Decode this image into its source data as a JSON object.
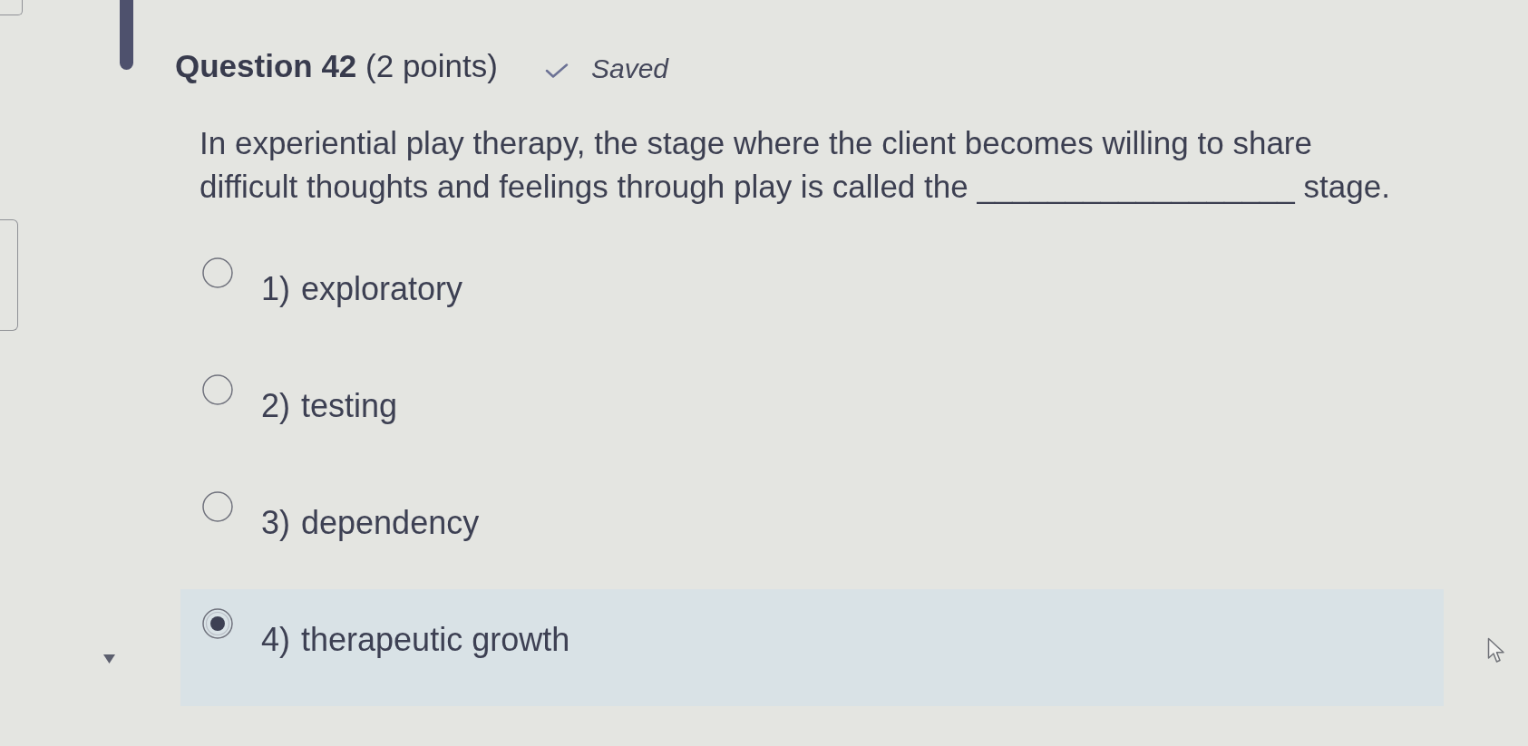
{
  "question": {
    "title": "**Question 42** (2 points)",
    "save_status": "Saved",
    "prompt": "In experiential play therapy, the stage where the client becomes willing to share difficult thoughts and feelings through play is called the __________________ stage.",
    "options": [
      {
        "number": "1)",
        "label": "exploratory",
        "selected": false
      },
      {
        "number": "2)",
        "label": "testing",
        "selected": false
      },
      {
        "number": "3)",
        "label": "dependency",
        "selected": false
      },
      {
        "number": "4)",
        "label": "therapeutic growth",
        "selected": true
      }
    ]
  }
}
